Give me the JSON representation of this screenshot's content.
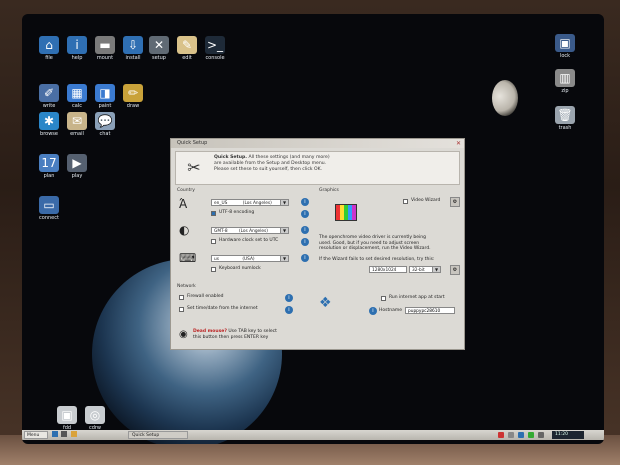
{
  "desktop": {
    "icons_left": [
      {
        "label": "file",
        "icon": "home-icon",
        "color": "#2f6fb3",
        "glyph": "⌂"
      },
      {
        "label": "help",
        "icon": "info-icon",
        "color": "#2f6fb3",
        "glyph": "i"
      },
      {
        "label": "mount",
        "icon": "drive-icon",
        "color": "#7a7a7a",
        "glyph": "▬"
      },
      {
        "label": "install",
        "icon": "install-icon",
        "color": "#2f6fb3",
        "glyph": "⇩"
      },
      {
        "label": "setup",
        "icon": "wrench-icon",
        "color": "#606a74",
        "glyph": "✕"
      },
      {
        "label": "edit",
        "icon": "edit-icon",
        "color": "#d9c28a",
        "glyph": "✎"
      },
      {
        "label": "console",
        "icon": "console-icon",
        "color": "#1e2a38",
        "glyph": ">_"
      },
      {
        "label": "write",
        "icon": "write-icon",
        "color": "#4a6fa5",
        "glyph": "✐"
      },
      {
        "label": "calc",
        "icon": "calc-icon",
        "color": "#3a7ad0",
        "glyph": "▦"
      },
      {
        "label": "paint",
        "icon": "paint-icon",
        "color": "#3a7ad0",
        "glyph": "◨"
      },
      {
        "label": "draw",
        "icon": "draw-icon",
        "color": "#c9a23a",
        "glyph": "✏"
      },
      {
        "label": "browse",
        "icon": "globe-icon",
        "color": "#2a86c8",
        "glyph": "✱"
      },
      {
        "label": "email",
        "icon": "email-icon",
        "color": "#c8b48a",
        "glyph": "✉"
      },
      {
        "label": "chat",
        "icon": "chat-icon",
        "color": "#8aa0b8",
        "glyph": "💬"
      },
      {
        "label": "plan",
        "icon": "calendar-icon",
        "color": "#4a7ec0",
        "glyph": "17"
      },
      {
        "label": "play",
        "icon": "media-icon",
        "color": "#556070",
        "glyph": "▶"
      },
      {
        "label": "connect",
        "icon": "network-icon",
        "color": "#3a6aa8",
        "glyph": "▭"
      }
    ],
    "icons_right": [
      {
        "label": "lock",
        "icon": "lock-icon",
        "color": "#3a5a8a",
        "glyph": "▣"
      },
      {
        "label": "zip",
        "icon": "archive-icon",
        "color": "#8a8a8a",
        "glyph": "▥"
      },
      {
        "label": "trash",
        "icon": "trash-icon",
        "color": "#9aa4ae",
        "glyph": "🗑"
      }
    ],
    "icons_bottom": [
      {
        "label": "fdd",
        "icon": "floppy-icon",
        "color": "#c8ccd0",
        "glyph": "▣"
      },
      {
        "label": "cdrw",
        "icon": "cd-icon",
        "color": "#c8ccd0",
        "glyph": "◎"
      }
    ]
  },
  "dialog": {
    "title": "Quick Setup",
    "close_glyph": "✕",
    "header_title": "Quick Setup.",
    "header_line1": "All these settings (and many more)",
    "header_line2": "are available from the Setup and Desktop menu.",
    "header_line3": "Please set these to suit yourself, then click OK.",
    "country_label": "Country",
    "graphics_label": "Graphics",
    "network_label": "Network",
    "locale_value": "en_US",
    "locale_city": "(Los Angeles)",
    "utf8_label": "UTF-8 encoding",
    "timezone_value": "GMT-8",
    "timezone_city": "(Los Angeles)",
    "hwclock_label": "Hardware clock set to UTC",
    "keyboard_value": "us",
    "keyboard_desc": "(USA)",
    "numlock_label": "Keyboard numlock",
    "video_wizard_label": "Video Wizard",
    "graphics_text1": "The openchrome video driver is currently being",
    "graphics_text2": "used. Good, but if you need to adjust screen",
    "graphics_text3": "resolution or displacement, run the Video Wizard.",
    "graphics_text4": "If the Wizard fails to set desired resolution, try this:",
    "resolution_value": "1280x1024",
    "depth_value": "32-bit",
    "firewall_label": "Firewall enabled",
    "timedate_label": "Set time/date from the internet",
    "run_internet_label": "Run internet app at start",
    "hostname_label": "Hostname",
    "hostname_value": "puppypc28610",
    "footer_title": "Dead mouse?",
    "footer_text1": "Use TAB key to select",
    "footer_text2": "this button then press ENTER key",
    "info_glyph": "i",
    "arrow_glyph": "▼"
  },
  "taskbar": {
    "menu_label": "Menu",
    "task_label": "Quick Setup",
    "clock": "11:20"
  }
}
